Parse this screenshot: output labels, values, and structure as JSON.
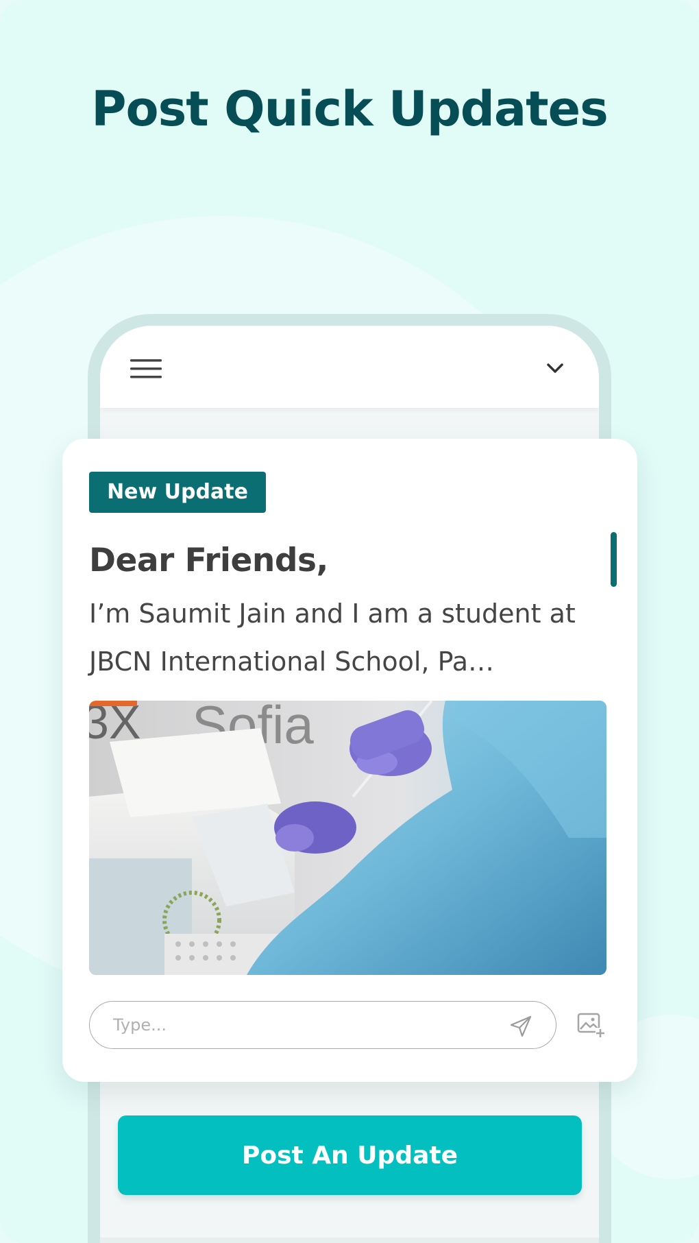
{
  "headline": "Post Quick Updates",
  "phone_header": {
    "menu_icon": "hamburger-menu-icon",
    "dropdown_icon": "chevron-down-icon"
  },
  "update_card": {
    "badge": "New Update",
    "greeting": "Dear Friends,",
    "message": "I’m Saumit Jain and I am a student at JBCN International School, Pa…",
    "photo_icon": "covid-test-photo",
    "composer": {
      "placeholder": "Type...",
      "send_icon": "send-icon",
      "attach_icon": "image-add-icon"
    }
  },
  "post_button_label": "Post An Update",
  "colors": {
    "brand_dark": "#064d55",
    "badge": "#0b6e73",
    "button": "#03bfbf",
    "background": "#e1fbf7"
  }
}
